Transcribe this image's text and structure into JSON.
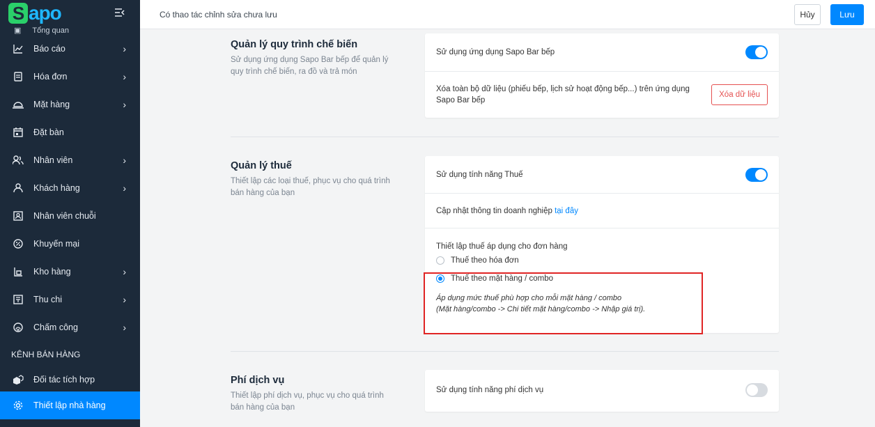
{
  "sidebar": {
    "logo": "Sapo",
    "partial_item": "Tổng quan",
    "items": [
      {
        "label": "Báo cáo",
        "icon": "chart-line-icon",
        "chevron": true
      },
      {
        "label": "Hóa đơn",
        "icon": "receipt-icon",
        "chevron": true
      },
      {
        "label": "Mặt hàng",
        "icon": "cloche-icon",
        "chevron": true
      },
      {
        "label": "Đặt bàn",
        "icon": "calendar-icon",
        "chevron": false
      },
      {
        "label": "Nhân viên",
        "icon": "users-icon",
        "chevron": true
      },
      {
        "label": "Khách hàng",
        "icon": "user-icon",
        "chevron": true
      },
      {
        "label": "Nhân viên chuỗi",
        "icon": "id-badge-icon",
        "chevron": false
      },
      {
        "label": "Khuyến mại",
        "icon": "discount-icon",
        "chevron": false
      },
      {
        "label": "Kho hàng",
        "icon": "warehouse-icon",
        "chevron": true
      },
      {
        "label": "Thu chi",
        "icon": "cash-icon",
        "chevron": true
      },
      {
        "label": "Chấm công",
        "icon": "fingerprint-icon",
        "chevron": true
      }
    ],
    "section_label": "KÊNH BÁN HÀNG",
    "channel_items": [
      {
        "label": "Đối tác tích hợp",
        "icon": "boxes-icon"
      },
      {
        "label": "Thiết lập nhà hàng",
        "icon": "gear-icon",
        "active": true
      }
    ]
  },
  "topbar": {
    "message": "Có thao tác chỉnh sửa chưa lưu",
    "cancel_label": "Hủy",
    "save_label": "Lưu"
  },
  "sections": {
    "kitchen": {
      "title": "Quản lý quy trình chế biến",
      "description": "Sử dụng ứng dụng Sapo Bar bếp để quản lý quy trình chế biến, ra đồ và trả món",
      "toggle_label": "Sử dụng ứng dụng Sapo Bar bếp",
      "toggle_on": true,
      "delete_text": "Xóa toàn bộ dữ liệu (phiếu bếp, lịch sử hoạt động bếp...) trên ứng dụng Sapo Bar bếp",
      "delete_button": "Xóa dữ liệu"
    },
    "tax": {
      "title": "Quản lý thuế",
      "description": "Thiết lập các loại thuế, phục vụ cho quá trình bán hàng của bạn",
      "toggle_label": "Sử dụng tính năng Thuế",
      "toggle_on": true,
      "update_text": "Cập nhật thông tin doanh nghiệp",
      "update_link": "tại đây",
      "apply_label": "Thiết lập thuế áp dụng cho đơn hàng",
      "option_invoice": "Thuế theo hóa đơn",
      "option_item": "Thuế theo mặt hàng / combo",
      "selected_option": "item",
      "hint_line1": "Áp dụng mức thuế phù hợp cho mỗi mặt hàng / combo",
      "hint_line2": "(Mặt hàng/combo -> Chi tiết mặt hàng/combo -> Nhập giá trị)."
    },
    "service_fee": {
      "title": "Phí dịch vụ",
      "description": "Thiết lập phí dịch vụ, phục vụ cho quá trình bán hàng của bạn",
      "toggle_label": "Sử dụng tính năng phí dịch vụ",
      "toggle_on": false
    }
  },
  "colors": {
    "accent": "#0088ff",
    "sidebar_bg": "#1c2a3a",
    "danger": "#e55050",
    "highlight": "#e02424"
  }
}
